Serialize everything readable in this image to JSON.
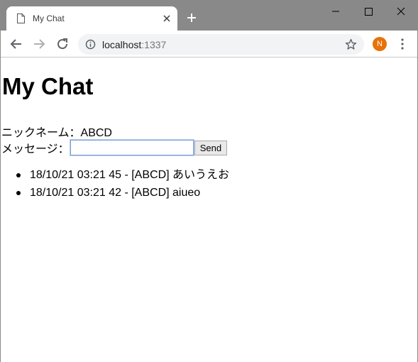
{
  "browser": {
    "tab_title": "My Chat",
    "url_host": "localhost",
    "url_port": ":1337",
    "profile_initial": "N",
    "profile_color": "#e8710a",
    "titlebar_color": "#898989"
  },
  "page": {
    "heading": "My Chat",
    "nickname_label": "ニックネーム：",
    "nickname_value": "ABCD",
    "message_label": "メッセージ：",
    "message_value": "",
    "send_label": "Send",
    "messages": [
      {
        "text": "18/10/21 03:21 45 - [ABCD] あいうえお"
      },
      {
        "text": "18/10/21 03:21 42 - [ABCD] aiueo"
      }
    ]
  },
  "icons": {
    "tab_favicon": "page-icon",
    "tab_close": "close-icon",
    "new_tab": "plus-icon",
    "back": "arrow-left-icon",
    "forward": "arrow-right-icon",
    "reload": "reload-icon",
    "site_info": "info-icon",
    "bookmark": "star-icon",
    "menu": "kebab-menu-icon"
  }
}
